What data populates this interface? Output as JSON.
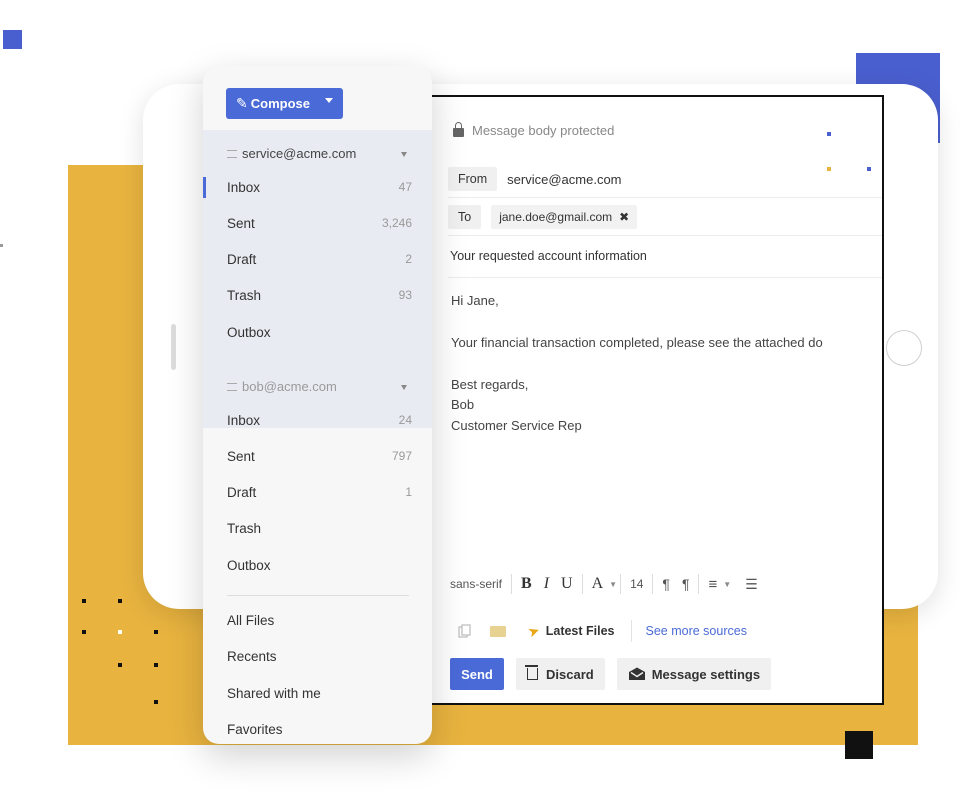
{
  "sidebar": {
    "compose_label": "Compose",
    "accounts": [
      {
        "email": "service@acme.com",
        "folders": [
          {
            "label": "Inbox",
            "count": "47"
          },
          {
            "label": "Sent",
            "count": "3,246"
          },
          {
            "label": "Draft",
            "count": "2"
          },
          {
            "label": "Trash",
            "count": "93"
          },
          {
            "label": "Outbox",
            "count": ""
          }
        ]
      },
      {
        "email": "bob@acme.com",
        "folders": [
          {
            "label": "Inbox",
            "count": "24"
          },
          {
            "label": "Sent",
            "count": "797"
          },
          {
            "label": "Draft",
            "count": "1"
          },
          {
            "label": "Trash",
            "count": ""
          },
          {
            "label": "Outbox",
            "count": ""
          }
        ]
      }
    ],
    "files": [
      "All Files",
      "Recents",
      "Shared with me",
      "Favorites"
    ]
  },
  "email": {
    "protected_label": "Message body protected",
    "from_tag": "From",
    "from_value": "service@acme.com",
    "to_tag": "To",
    "to_value": "jane.doe@gmail.com",
    "to_remove": "✖",
    "subject": "Your requested account information",
    "body_lines": [
      "Hi Jane,",
      "Your financial transaction completed, please see the attached do",
      "Best regards,",
      "Bob",
      "Customer Service Rep"
    ]
  },
  "toolbar": {
    "font_name": "sans-serif",
    "bold": "B",
    "italic": "I",
    "underline": "U",
    "font_color": "A",
    "font_size": "14",
    "ltr": "¶",
    "rtl": "¶",
    "align": "≡",
    "list": "☰"
  },
  "attachments": {
    "latest_label": "Latest Files",
    "see_more_label": "See more sources"
  },
  "actions": {
    "send_label": "Send",
    "discard_label": "Discard",
    "settings_label": "Message settings"
  },
  "colors": {
    "accent_blue": "#4a6ad8",
    "brand_yellow": "#e8b33f",
    "deco_blue": "#4a5fcf"
  }
}
